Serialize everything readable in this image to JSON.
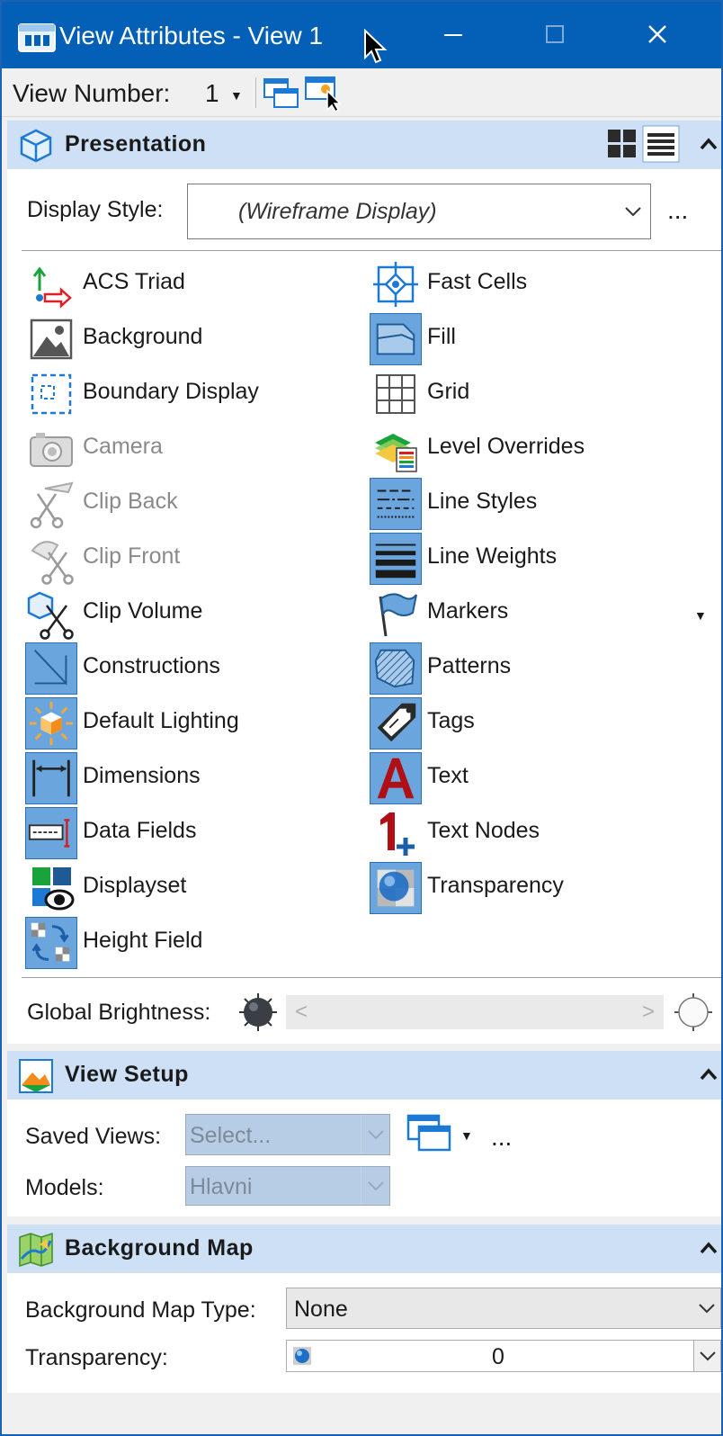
{
  "window": {
    "title": "View Attributes - View 1",
    "minimize_icon": "minimize-icon",
    "maximize_icon": "maximize-icon",
    "close_icon": "close-icon"
  },
  "toolbar": {
    "view_number_label": "View Number:",
    "view_number_value": "1"
  },
  "presentation": {
    "title": "Presentation",
    "display_style_label": "Display Style:",
    "display_style_value": "(Wireframe Display)",
    "more_label": "...",
    "left_items": [
      {
        "label": "ACS Triad",
        "icon": "acs-triad-icon"
      },
      {
        "label": "Background",
        "icon": "background-icon"
      },
      {
        "label": "Boundary Display",
        "icon": "boundary-display-icon"
      },
      {
        "label": "Camera",
        "icon": "camera-icon"
      },
      {
        "label": "Clip Back",
        "icon": "clip-back-icon"
      },
      {
        "label": "Clip Front",
        "icon": "clip-front-icon"
      },
      {
        "label": "Clip Volume",
        "icon": "clip-volume-icon"
      },
      {
        "label": "Constructions",
        "icon": "constructions-icon"
      },
      {
        "label": "Default Lighting",
        "icon": "default-lighting-icon"
      },
      {
        "label": "Dimensions",
        "icon": "dimensions-icon"
      },
      {
        "label": "Data Fields",
        "icon": "data-fields-icon"
      },
      {
        "label": "Displayset",
        "icon": "displayset-icon"
      },
      {
        "label": "Height Field",
        "icon": "height-field-icon"
      }
    ],
    "right_items": [
      {
        "label": "Fast Cells",
        "icon": "fast-cells-icon"
      },
      {
        "label": "Fill",
        "icon": "fill-icon"
      },
      {
        "label": "Grid",
        "icon": "grid-icon"
      },
      {
        "label": "Level Overrides",
        "icon": "level-overrides-icon"
      },
      {
        "label": "Line Styles",
        "icon": "line-styles-icon"
      },
      {
        "label": "Line Weights",
        "icon": "line-weights-icon"
      },
      {
        "label": "Markers",
        "icon": "markers-icon"
      },
      {
        "label": "Patterns",
        "icon": "patterns-icon"
      },
      {
        "label": "Tags",
        "icon": "tags-icon"
      },
      {
        "label": "Text",
        "icon": "text-icon"
      },
      {
        "label": "Text Nodes",
        "icon": "text-nodes-icon"
      },
      {
        "label": "Transparency",
        "icon": "transparency-icon"
      }
    ],
    "global_brightness_label": "Global Brightness:"
  },
  "view_setup": {
    "title": "View Setup",
    "saved_views_label": "Saved Views:",
    "saved_views_placeholder": "Select...",
    "models_label": "Models:",
    "models_value": "Hlavni",
    "more_label": "..."
  },
  "background_map": {
    "title": "Background Map",
    "type_label": "Background Map Type:",
    "type_value": "None",
    "transparency_label": "Transparency:",
    "transparency_value": "0"
  },
  "colors": {
    "titlebar": "#0460b6",
    "section_header": "#cde0f6",
    "active_icon": "#6aa6dd"
  }
}
